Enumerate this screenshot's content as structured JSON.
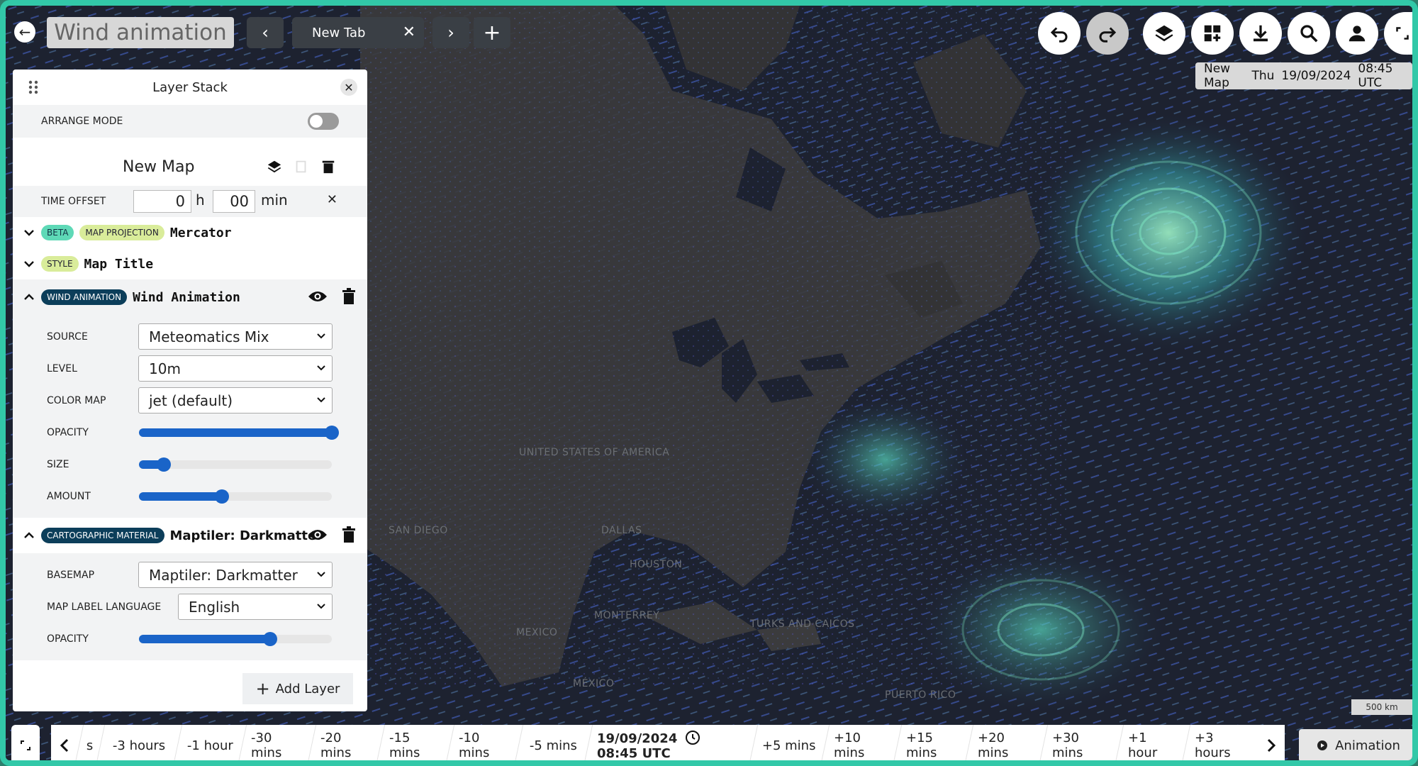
{
  "top": {
    "map_title": "Wind animation",
    "tab_label": "New Tab",
    "tab_close": "✕",
    "prev": "‹",
    "next": "›",
    "add": "+"
  },
  "info": {
    "map": "New Map",
    "day": "Thu",
    "date": "19/09/2024",
    "time": "08:45 UTC"
  },
  "panel": {
    "title": "Layer Stack",
    "arrange_label": "ARRANGE MODE",
    "map_name": "New Map",
    "time_offset_label": "TIME OFFSET",
    "hours": "0",
    "hours_unit": "h",
    "mins": "00",
    "mins_unit": "min",
    "projection": {
      "beta": "BETA",
      "badge": "MAP PROJECTION",
      "value": "Mercator"
    },
    "style": {
      "badge": "STYLE",
      "value": "Map Title"
    },
    "wind": {
      "badge": "WIND ANIMATION",
      "name": "Wind Animation",
      "source_label": "SOURCE",
      "source": "Meteomatics Mix",
      "level_label": "LEVEL",
      "level": "10m",
      "colormap_label": "COLOR MAP",
      "colormap": "jet (default)",
      "opacity_label": "OPACITY",
      "opacity": 1.0,
      "size_label": "SIZE",
      "size": 0.13,
      "amount_label": "AMOUNT",
      "amount": 0.43
    },
    "carto": {
      "badge": "CARTOGRAPHIC MATERIAL",
      "name": "Maptiler: Darkmatter",
      "basemap_label": "BASEMAP",
      "basemap": "Maptiler: Darkmatter",
      "lang_label": "MAP LABEL LANGUAGE",
      "lang": "English",
      "opacity_label": "OPACITY",
      "opacity": 0.68
    },
    "add_layer": "Add Layer"
  },
  "timeline": {
    "items": [
      "s",
      "-3 hours",
      "-1 hour",
      "-30 mins",
      "-20 mins",
      "-15 mins",
      "-10 mins",
      "-5 mins"
    ],
    "current_date": "19/09/2024",
    "current_time": "08:45 UTC",
    "after": [
      "+5 mins",
      "+10 mins",
      "+15 mins",
      "+20 mins",
      "+30 mins",
      "+1 hour",
      "+3 hours"
    ],
    "animation": "Animation"
  },
  "map": {
    "scale": "500 km",
    "labels": [
      "UNITED STATES OF AMERICA",
      "HOUSTON",
      "DALLAS",
      "SAN DIEGO",
      "MONTERREY",
      "MEXICO",
      "MÉXICO",
      "TURKS AND CAICOS",
      "PUERTO RICO"
    ]
  }
}
